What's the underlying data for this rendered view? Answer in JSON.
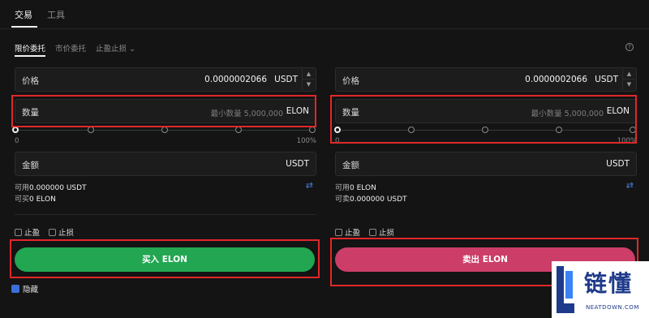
{
  "top_tabs": [
    {
      "label": "交易"
    },
    {
      "label": "工具"
    }
  ],
  "order_tabs": [
    {
      "label": "限价委托"
    },
    {
      "label": "市价委托"
    },
    {
      "label": "止盈止损"
    }
  ],
  "buy": {
    "price_label": "价格",
    "price_value": "0.0000002066",
    "price_unit": "USDT",
    "qty_label": "数量",
    "qty_placeholder": "最小数量 5,000,000",
    "qty_unit": "ELON",
    "slider_min": "0",
    "slider_max": "100%",
    "slider_level": 0,
    "amount_label": "金额",
    "amount_unit": "USDT",
    "available_label": "可用",
    "available_value": "0.000000 USDT",
    "can_label": "可买",
    "can_value": "0 ELON",
    "take_profit": "止盈",
    "stop_loss": "止损",
    "button_label": "买入 ELON"
  },
  "sell": {
    "price_label": "价格",
    "price_value": "0.0000002066",
    "price_unit": "USDT",
    "qty_label": "数量",
    "qty_placeholder": "最小数量 5,000,000",
    "qty_unit": "ELON",
    "slider_min": "0",
    "slider_max": "100%",
    "slider_level": 0,
    "amount_label": "金额",
    "amount_unit": "USDT",
    "available_label": "可用",
    "available_value": "0 ELON",
    "can_label": "可卖",
    "can_value": "0.000000 USDT",
    "take_profit": "止盈",
    "stop_loss": "止损",
    "button_label": "卖出 ELON"
  },
  "bottom_checkbox_label": "隐藏",
  "watermark": {
    "text": "链懂",
    "sub": "NEATDOWN.COM"
  },
  "colors": {
    "buy": "#22a652",
    "sell": "#cc3d68",
    "highlight": "#e0282a",
    "link": "#4a7fe0"
  },
  "icons": {
    "help": "question-circle-icon",
    "swap": "swap-icon",
    "dropdown": "chevron-down-icon"
  }
}
